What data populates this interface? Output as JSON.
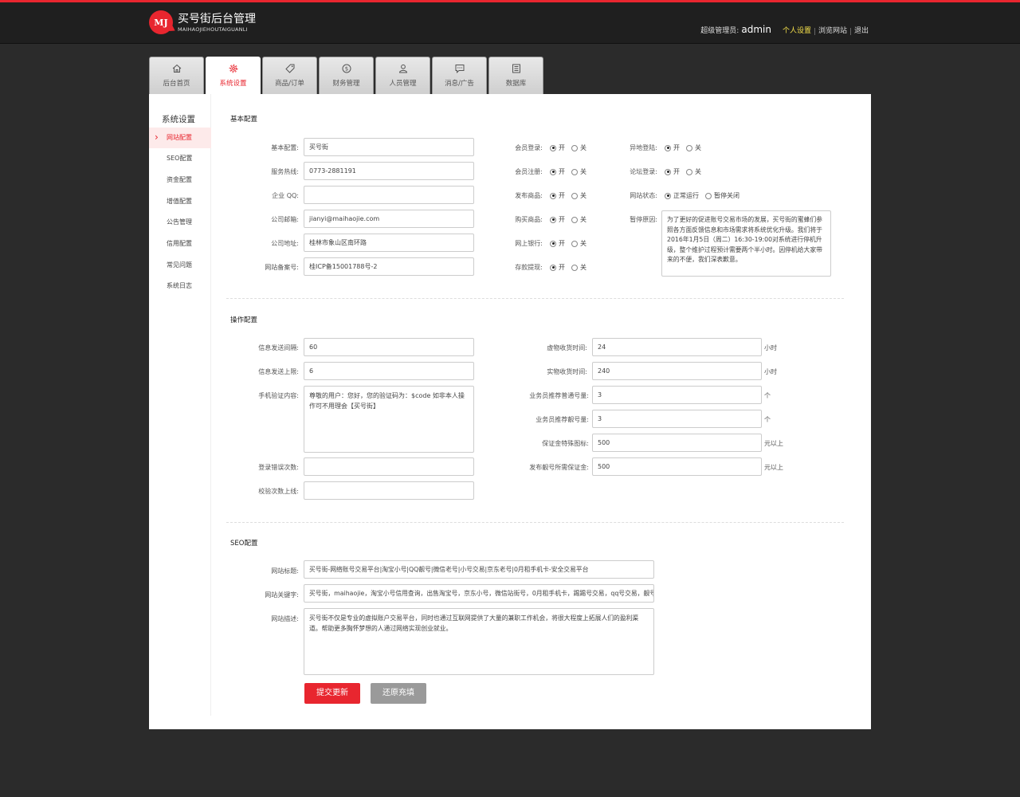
{
  "header": {
    "logo_mark": "MJ",
    "app_title": "买号街后台管理",
    "app_subtitle": "MAIHAOJIEHOUTAIGUANLI",
    "role_label": "超级管理员:",
    "username": "admin",
    "links": [
      "个人设置",
      "浏览网站",
      "退出"
    ]
  },
  "tabs": [
    {
      "label": "后台首页",
      "icon": "home-icon"
    },
    {
      "label": "系统设置",
      "icon": "gear-icon"
    },
    {
      "label": "商品/订单",
      "icon": "tag-icon"
    },
    {
      "label": "财务管理",
      "icon": "dollar-icon"
    },
    {
      "label": "人员管理",
      "icon": "user-icon"
    },
    {
      "label": "消息/广告",
      "icon": "message-icon"
    },
    {
      "label": "数据库",
      "icon": "database-icon"
    }
  ],
  "sidenav": {
    "title": "系统设置",
    "items": [
      "网站配置",
      "SEO配置",
      "资金配置",
      "增值配置",
      "公告管理",
      "信用配置",
      "常见问题",
      "系统日志"
    ]
  },
  "basic": {
    "title": "基本配置",
    "fields": [
      {
        "label": "基本配置:",
        "value": "买号街"
      },
      {
        "label": "服务热线:",
        "value": "0773-2881191"
      },
      {
        "label": "企业 QQ:",
        "value": ""
      },
      {
        "label": "公司邮箱:",
        "value": "jianyi@maihaojie.com"
      },
      {
        "label": "公司地址:",
        "value": "桂林市象山区南环路"
      },
      {
        "label": "网站备案号:",
        "value": "桂ICP备15001788号-2"
      }
    ],
    "switches_mid": [
      {
        "label": "会员登录:",
        "on": "开",
        "off": "关"
      },
      {
        "label": "会员注册:",
        "on": "开",
        "off": "关"
      },
      {
        "label": "发布商品:",
        "on": "开",
        "off": "关"
      },
      {
        "label": "购买商品:",
        "on": "开",
        "off": "关"
      },
      {
        "label": "网上银行:",
        "on": "开",
        "off": "关"
      },
      {
        "label": "存款提现:",
        "on": "开",
        "off": "关"
      }
    ],
    "switches_right": [
      {
        "label": "异地登陆:",
        "on": "开",
        "off": "关"
      },
      {
        "label": "论坛登录:",
        "on": "开",
        "off": "关"
      },
      {
        "label": "网站状态:",
        "on": "正常运行",
        "off": "暂停关闭"
      }
    ],
    "pause_label": "暂停原因:",
    "pause_reason": "为了更好的促进账号交易市场的发展，买号街的蜜蜂们参照各方面反馈信息和市场需求将系统优化升级。我们将于2016年1月5日（周二）16:30-19:00对系统进行停机升级，整个维护过程预计需要两个半小时。因停机给大家带来的不便，我们深表歉意。"
  },
  "ops": {
    "title": "操作配置",
    "left": [
      {
        "label": "信息发送间隔:",
        "value": "60"
      },
      {
        "label": "信息发送上限:",
        "value": "6"
      }
    ],
    "sms_label": "手机验证内容:",
    "sms_value": "尊敬的用户：您好，您的验证码为：$code 如非本人操作可不用理会【买号街】",
    "left_bottom": [
      {
        "label": "登录错误次数:",
        "value": ""
      },
      {
        "label": "校验次数上线:",
        "value": ""
      }
    ],
    "right": [
      {
        "label": "虚物收货时间:",
        "value": "24",
        "unit": "小时"
      },
      {
        "label": "实物收货时间:",
        "value": "240",
        "unit": "小时"
      },
      {
        "label": "业务员推荐普通号量:",
        "value": "3",
        "unit": "个"
      },
      {
        "label": "业务员推荐靓号量:",
        "value": "3",
        "unit": "个"
      },
      {
        "label": "保证金特殊图标:",
        "value": "500",
        "unit": "元以上"
      },
      {
        "label": "发布靓号所需保证金:",
        "value": "500",
        "unit": "元以上"
      }
    ]
  },
  "seo": {
    "title": "SEO配置",
    "site_title_label": "网站标题:",
    "site_title": "买号街-网络账号交易平台|淘宝小号|QQ靓号|微信老号|小号交易|京东老号|0月租手机卡-安全交易平台",
    "keywords_label": "网站关键字:",
    "keywords": "买号街，maihaojie，淘宝小号信用查询，出售淘宝号，京东小号，微信站街号，0月租手机卡，踢踢号交易，qq号交易，靓号交易",
    "desc_label": "网站描述:",
    "desc": "买号街不仅是专业的虚拟账户交易平台，同时也通过互联网提供了大量的兼职工作机会，将很大程度上拓展人们的盈利渠道。帮助更多胸怀梦想的人通过网络实现创业就业。"
  },
  "buttons": {
    "submit": "提交更新",
    "reset": "还原充填"
  },
  "colors": {
    "accent": "#e8262f",
    "header_bg": "#1f1f1f",
    "page_bg": "#2b2b2b"
  }
}
